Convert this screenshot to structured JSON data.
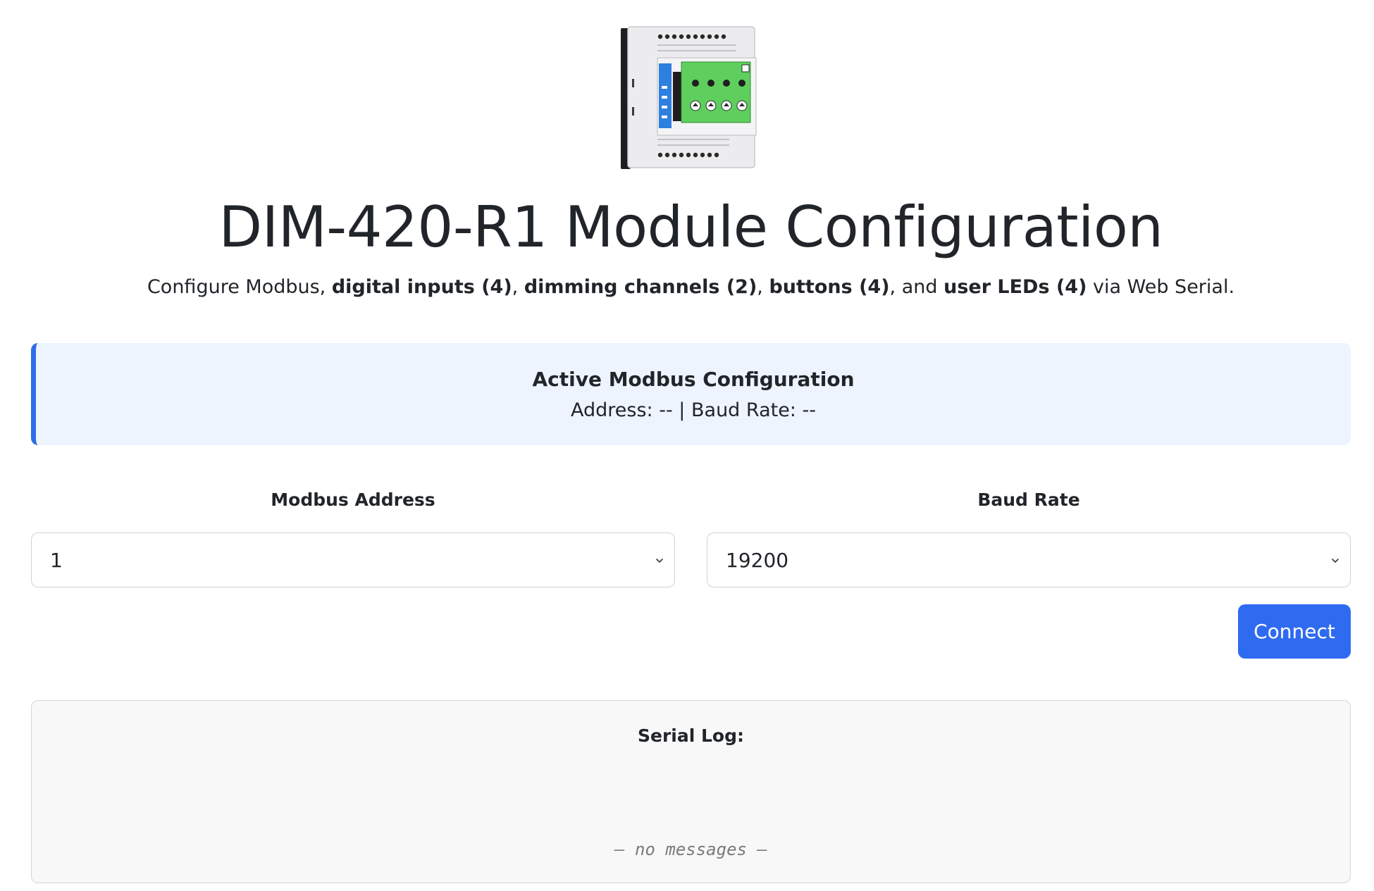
{
  "header": {
    "image_alt": "DIM-420-R1 module",
    "title": "DIM-420-R1 Module Configuration",
    "subtitle": {
      "p1": "Configure Modbus, ",
      "b1": "digital inputs (4)",
      "p2": ", ",
      "b2": "dimming channels (2)",
      "p3": ", ",
      "b3": "buttons (4)",
      "p4": ", and ",
      "b4": "user LEDs (4)",
      "p5": " via Web Serial."
    }
  },
  "active_config": {
    "title": "Active Modbus Configuration",
    "address_label": "Address:",
    "address_value": "--",
    "separator": "|",
    "baud_label": "Baud Rate:",
    "baud_value": "--"
  },
  "form": {
    "address": {
      "label": "Modbus Address",
      "value": "1"
    },
    "baud": {
      "label": "Baud Rate",
      "value": "19200"
    },
    "connect_label": "Connect"
  },
  "serial_log": {
    "title": "Serial Log:",
    "empty_text": "— no messages —"
  },
  "colors": {
    "accent": "#2f6bf0",
    "info_bg": "#eef4fe",
    "module_green": "#5ecf5e",
    "module_blue": "#2d7fe0"
  }
}
